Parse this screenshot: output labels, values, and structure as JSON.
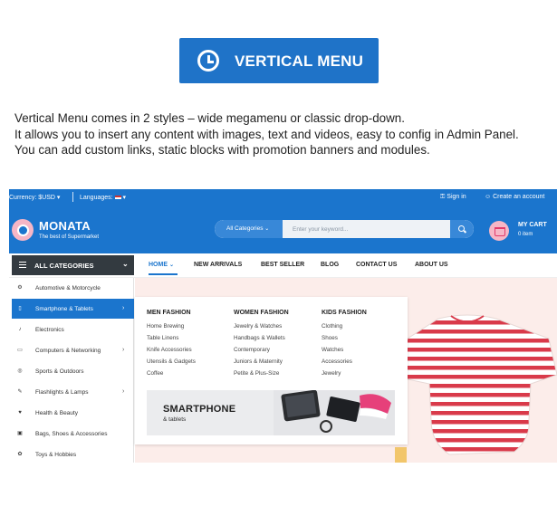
{
  "promo": {
    "badge_title": "VERTICAL MENU",
    "description": [
      "Vertical Menu comes in 2 styles – wide megamenu or classic drop-down.",
      "It allows you to insert any content with images, text and videos, easy to config in Admin Panel.",
      "You can add custom links, static blocks with promotion banners and modules."
    ]
  },
  "store": {
    "topbar": {
      "currency": "Currency: $USD",
      "languages": "Languages:",
      "sign_in": "Sign in",
      "create_account": "Create an account"
    },
    "header": {
      "logo_name": "MONATA",
      "logo_tagline": "The best of Supermarket",
      "search_category": "All Categories",
      "search_placeholder": "Enter your keyword...",
      "cart_title": "MY CART",
      "cart_count": "0 item"
    },
    "nav": {
      "all_categories": "ALL CATEGORIES",
      "links": [
        "HOME",
        "NEW ARRIVALS",
        "BEST SELLER",
        "BLOG",
        "CONTACT US",
        "ABOUT US"
      ]
    },
    "side_menu": [
      {
        "label": "Automotive & Motorcycle",
        "icon": "motorcycle-icon",
        "glyph": "⚙",
        "submenu": false
      },
      {
        "label": "Smartphone & Tablets",
        "icon": "phone-icon",
        "glyph": "▯",
        "submenu": true,
        "active": true
      },
      {
        "label": "Electronics",
        "icon": "microphone-icon",
        "glyph": "♪",
        "submenu": false
      },
      {
        "label": "Computers & Networking",
        "icon": "monitor-icon",
        "glyph": "▭",
        "submenu": true
      },
      {
        "label": "Sports & Outdoors",
        "icon": "ball-icon",
        "glyph": "◎",
        "submenu": false
      },
      {
        "label": "Flashlights & Lamps",
        "icon": "flashlight-icon",
        "glyph": "✎",
        "submenu": true
      },
      {
        "label": "Health & Beauty",
        "icon": "heart-icon",
        "glyph": "♥",
        "submenu": false
      },
      {
        "label": "Bags, Shoes & Accessories",
        "icon": "bag-icon",
        "glyph": "▣",
        "submenu": false
      },
      {
        "label": "Toys & Hobbies",
        "icon": "toy-icon",
        "glyph": "✿",
        "submenu": false
      }
    ],
    "mega_menu": {
      "columns": [
        {
          "title": "MEN FASHION",
          "links": [
            "Home Brewing",
            "Table Linens",
            "Knife Accessories",
            "Utensils & Gadgets",
            "Coffee"
          ]
        },
        {
          "title": "WOMEN FASHION",
          "links": [
            "Jewelry & Watches",
            "Handbags & Wallets",
            "Contemporary",
            "Juniors & Maternity",
            "Petite & Plus-Size"
          ]
        },
        {
          "title": "KIDS FASHION",
          "links": [
            "Clothing",
            "Shoes",
            "Watches",
            "Accessories",
            "Jewelry"
          ]
        }
      ],
      "banner_title": "SMARTPHONE",
      "banner_subtitle": "& tablets"
    },
    "colors": {
      "primary": "#1b75cd",
      "badge": "#1f73c8",
      "dark": "#333a40",
      "accent_pink": "#f6b6c6",
      "hero_bg": "#fcedea"
    }
  }
}
